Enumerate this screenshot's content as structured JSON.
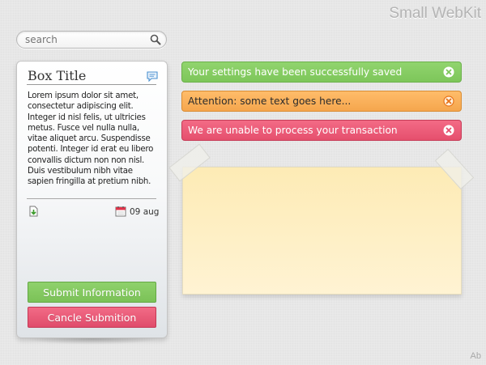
{
  "brand": "Small WebKit",
  "search": {
    "placeholder": "search"
  },
  "box": {
    "title": "Box Title",
    "body": "Lorem ipsum dolor sit amet, consectetur adipiscing elit. Integer id nisl felis, ut ultricies metus. Fusce vel nulla nulla, vitae aliquet arcu. Suspendisse potenti. Integer id erat eu libero convallis dictum non non nisl. Duis vestibulum nibh vitae sapien fringilla at pretium nibh.",
    "date": "09 aug",
    "submit_label": "Submit Information",
    "cancel_label": "Cancle Submition"
  },
  "alerts": {
    "success": "Your settings have been successfully saved",
    "warning": "Attention: some text goes here...",
    "error": "We are unable to process your transaction"
  },
  "credit": "Ab",
  "colors": {
    "success": "#7dc65a",
    "warning": "#f5a64d",
    "error": "#e54f6d",
    "note": "#fdebb5"
  },
  "icons": [
    "search-icon",
    "chat-icon",
    "download-icon",
    "calendar-icon",
    "close-icon"
  ]
}
